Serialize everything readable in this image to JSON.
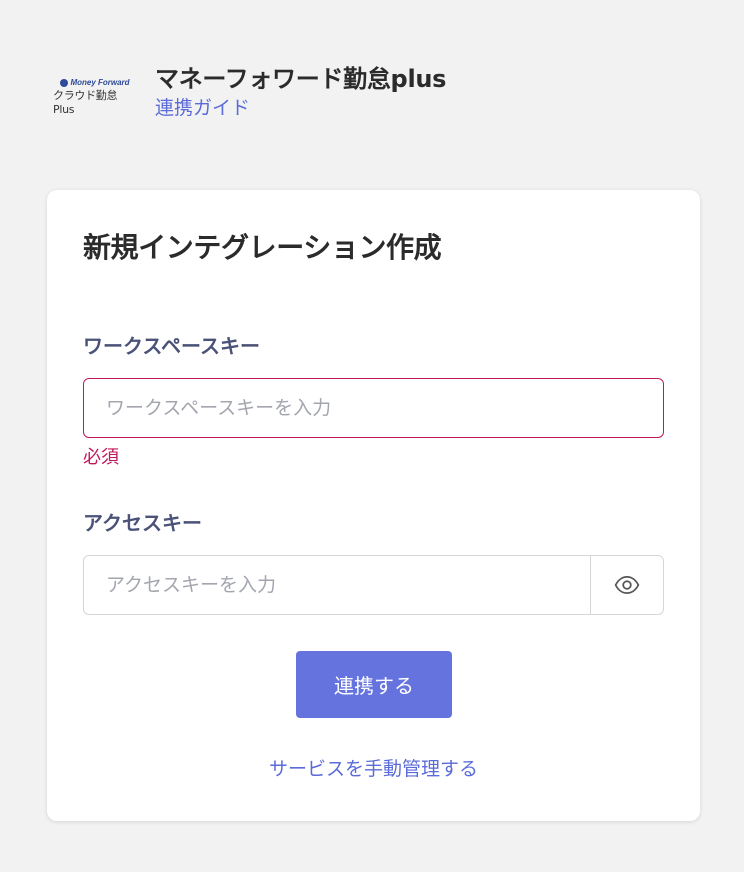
{
  "header": {
    "logo_top": "Money Forward",
    "logo_bottom": "クラウド勤怠Plus",
    "app_title": "マネーフォワード勤怠plus",
    "guide_link": "連携ガイド"
  },
  "card": {
    "title": "新規インテグレーション作成",
    "workspace_key": {
      "label": "ワークスペースキー",
      "placeholder": "ワークスペースキーを入力",
      "value": "",
      "error": "必須"
    },
    "access_key": {
      "label": "アクセスキー",
      "placeholder": "アクセスキーを入力",
      "value": ""
    },
    "submit_label": "連携する",
    "manual_link": "サービスを手動管理する"
  },
  "colors": {
    "accent": "#6573de",
    "link": "#5b6bd8",
    "error": "#c2185b",
    "label": "#4a5278"
  }
}
